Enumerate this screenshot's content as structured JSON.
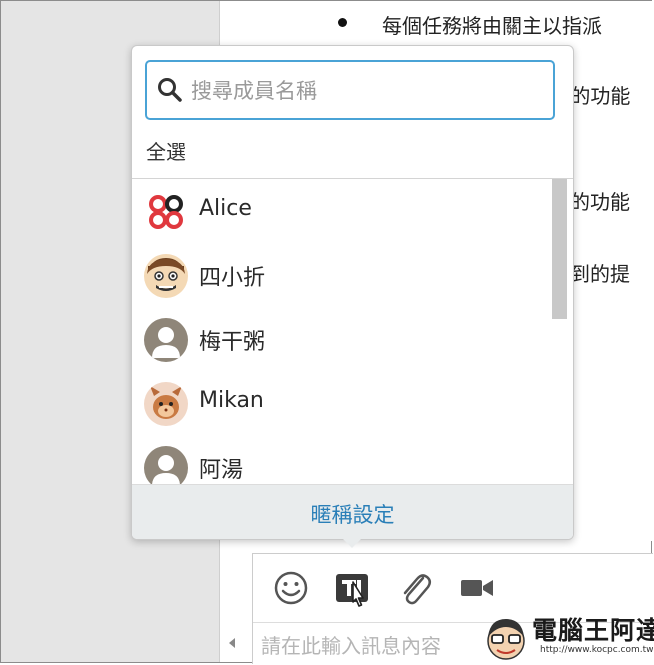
{
  "document": {
    "lines": [
      "每個任務將由關主以指派",
      "”的功能",
      "的功能",
      "到的提"
    ]
  },
  "mention_popup": {
    "search_placeholder": "搜尋成員名稱",
    "select_all_label": "全選",
    "members": [
      {
        "name": "Alice",
        "avatar": "flower-logo-avatar"
      },
      {
        "name": "四小折",
        "avatar": "cartoon-face-avatar"
      },
      {
        "name": "梅干粥",
        "avatar": "default-user-avatar"
      },
      {
        "name": "Mikan",
        "avatar": "cartoon-character-avatar"
      },
      {
        "name": "阿湯",
        "avatar": "default-user-avatar"
      }
    ],
    "footer_link": "暱稱設定"
  },
  "composer": {
    "toolbar": [
      "emoji-icon",
      "mention-icon",
      "attachment-icon",
      "video-icon"
    ],
    "input_placeholder": "請在此輸入訊息內容"
  },
  "watermark": {
    "title": "電腦王阿達",
    "url": "http://www.kocpc.com.tw"
  },
  "colors": {
    "accent": "#4aa3d6",
    "link": "#2a7fb8",
    "footer_bg": "#e9eced"
  }
}
